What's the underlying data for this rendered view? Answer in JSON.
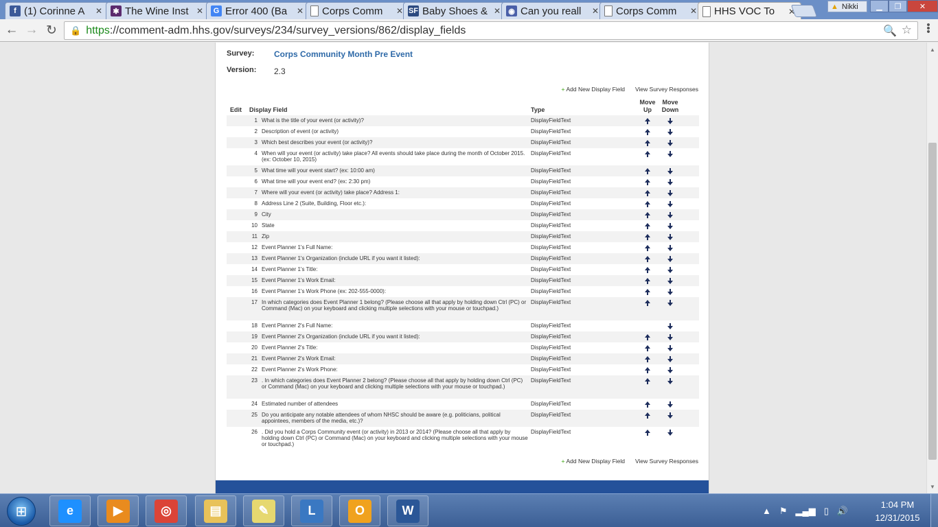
{
  "browser": {
    "tabs": [
      {
        "title": "(1) Corinne A",
        "icon": "facebook-icon",
        "color": "#3b5998",
        "glyph": "f"
      },
      {
        "title": "The Wine Inst",
        "icon": "wine-institute-icon",
        "color": "#5b2a6e",
        "glyph": "✱"
      },
      {
        "title": "Error 400 (Ba",
        "icon": "google-icon",
        "color": "#4285f4",
        "glyph": "G"
      },
      {
        "title": "Corps Comm",
        "icon": "page-icon",
        "color": "#ffffff",
        "glyph": ""
      },
      {
        "title": "Baby Shoes &",
        "icon": "sf-icon",
        "color": "#2c4a80",
        "glyph": "SF"
      },
      {
        "title": "Can you reall",
        "icon": "eye-icon",
        "color": "#4a5fa8",
        "glyph": "◉"
      },
      {
        "title": "Corps Comm",
        "icon": "page-icon",
        "color": "#ffffff",
        "glyph": ""
      },
      {
        "title": "HHS VOC To",
        "icon": "page-icon",
        "color": "#ffffff",
        "glyph": ""
      }
    ],
    "profile_name": "Nikki",
    "url_scheme": "https",
    "url_rest": "://comment-adm.hhs.gov/surveys/234/survey_versions/862/display_fields"
  },
  "page": {
    "survey_label": "Survey:",
    "survey_name": "Corps Community Month Pre Event",
    "version_label": "Version:",
    "version_value": "2.3",
    "add_field_label": "Add New Display Field",
    "view_responses_label": "View Survey Responses",
    "columns": {
      "edit": "Edit",
      "display_field": "Display Field",
      "type": "Type",
      "move_up_1": "Move",
      "move_up_2": "Up",
      "move_down_1": "Move",
      "move_down_2": "Down"
    },
    "rows": [
      {
        "num": "1",
        "field": "What is the title of your event (or activity)?",
        "type": "DisplayFieldText",
        "up": true,
        "down": true
      },
      {
        "num": "2",
        "field": "Description of event (or activity)",
        "type": "DisplayFieldText",
        "up": true,
        "down": true
      },
      {
        "num": "3",
        "field": "Which best describes your event (or activity)?",
        "type": "DisplayFieldText",
        "up": true,
        "down": true
      },
      {
        "num": "4",
        "field": "When will your event (or activity) take place? All events should take place during the month of October 2015. (ex: October 10, 2015)",
        "type": "DisplayFieldText",
        "up": true,
        "down": true
      },
      {
        "num": "5",
        "field": "What time will your event start? (ex: 10:00 am)",
        "type": "DisplayFieldText",
        "up": true,
        "down": true
      },
      {
        "num": "6",
        "field": "What time will your event end? (ex: 2:30 pm)",
        "type": "DisplayFieldText",
        "up": true,
        "down": true
      },
      {
        "num": "7",
        "field": "Where will your event (or activity) take place? Address 1:",
        "type": "DisplayFieldText",
        "up": true,
        "down": true
      },
      {
        "num": "8",
        "field": "Address Line 2 (Suite, Building, Floor etc.):",
        "type": "DisplayFieldText",
        "up": true,
        "down": true
      },
      {
        "num": "9",
        "field": "City",
        "type": "DisplayFieldText",
        "up": true,
        "down": true
      },
      {
        "num": "10",
        "field": "State",
        "type": "DisplayFieldText",
        "up": true,
        "down": true
      },
      {
        "num": "11",
        "field": "Zip",
        "type": "DisplayFieldText",
        "up": true,
        "down": true
      },
      {
        "num": "12",
        "field": "Event Planner 1's Full Name:",
        "type": "DisplayFieldText",
        "up": true,
        "down": true
      },
      {
        "num": "13",
        "field": "Event Planner 1's Organization (include URL if you want it listed):",
        "type": "DisplayFieldText",
        "up": true,
        "down": true
      },
      {
        "num": "14",
        "field": "Event Planner 1's Title:",
        "type": "DisplayFieldText",
        "up": true,
        "down": true
      },
      {
        "num": "15",
        "field": "Event Planner 1's Work Email:",
        "type": "DisplayFieldText",
        "up": true,
        "down": true
      },
      {
        "num": "16",
        "field": "Event Planner 1's Work Phone (ex: 202-555-0000):",
        "type": "DisplayFieldText",
        "up": true,
        "down": true
      },
      {
        "num": "17",
        "field": "In which categories does Event Planner 1 belong? (Please choose all that apply by holding down Ctrl (PC) or Command (Mac) on your keyboard and clicking multiple selections with your mouse or touchpad.)",
        "type": "DisplayFieldText",
        "up": true,
        "down": true
      },
      {
        "num": "18",
        "field": "Event Planner 2's Full Name:",
        "type": "DisplayFieldText",
        "up": false,
        "down": true
      },
      {
        "num": "19",
        "field": "Event Planner 2's Organization (include URL if you want it listed):",
        "type": "DisplayFieldText",
        "up": true,
        "down": true
      },
      {
        "num": "20",
        "field": "Event Planner 2's Title:",
        "type": "DisplayFieldText",
        "up": true,
        "down": true
      },
      {
        "num": "21",
        "field": "Event Planner 2's Work Email:",
        "type": "DisplayFieldText",
        "up": true,
        "down": true
      },
      {
        "num": "22",
        "field": "Event Planner 2's Work Phone:",
        "type": "DisplayFieldText",
        "up": true,
        "down": true
      },
      {
        "num": "23",
        "field": ". In which categories does Event Planner 2 belong? (Please choose all that apply by holding down Ctrl (PC) or Command (Mac) on your keyboard and clicking multiple selections with your mouse or touchpad.)",
        "type": "DisplayFieldText",
        "up": true,
        "down": true
      },
      {
        "num": "24",
        "field": "Estimated number of attendees",
        "type": "DisplayFieldText",
        "up": true,
        "down": true
      },
      {
        "num": "25",
        "field": "Do you anticipate any notable attendees of whom NHSC should be aware (e.g. politicians, political appointees, members of the media, etc.)?",
        "type": "DisplayFieldText",
        "up": true,
        "down": true
      },
      {
        "num": "26",
        "field": ". Did you hold a Corps Community event (or activity) in 2013 or 2014? (Please choose all that apply by holding down Ctrl (PC) or Command (Mac) on your keyboard and clicking multiple selections with your mouse or touchpad.)",
        "type": "DisplayFieldText",
        "up": true,
        "down": true
      }
    ]
  },
  "taskbar": {
    "apps": [
      {
        "name": "internet-explorer-icon",
        "glyph": "e",
        "color": "#1e90ff"
      },
      {
        "name": "media-player-icon",
        "glyph": "▶",
        "color": "#e98b1e"
      },
      {
        "name": "chrome-icon",
        "glyph": "◎",
        "color": "#db4437"
      },
      {
        "name": "file-explorer-icon",
        "glyph": "▤",
        "color": "#e8c25a"
      },
      {
        "name": "sticky-notes-icon",
        "glyph": "✎",
        "color": "#e6d870"
      },
      {
        "name": "lync-icon",
        "glyph": "L",
        "color": "#3a78c2"
      },
      {
        "name": "outlook-icon",
        "glyph": "O",
        "color": "#f0a21e"
      },
      {
        "name": "word-icon",
        "glyph": "W",
        "color": "#2b5797"
      }
    ],
    "time": "1:04 PM",
    "date": "12/31/2015"
  }
}
